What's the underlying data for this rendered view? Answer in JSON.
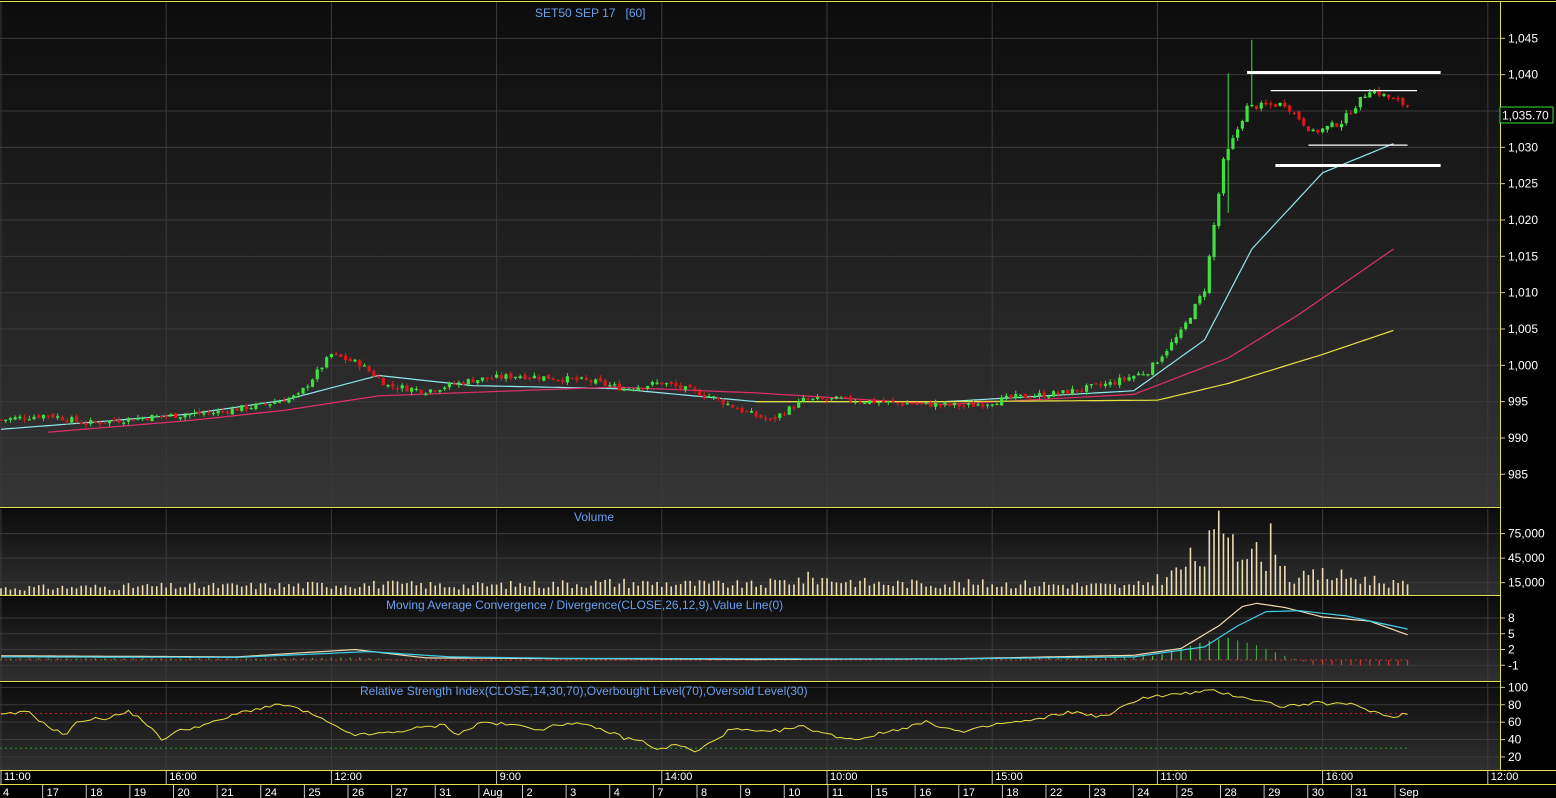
{
  "chart_data": [
    {
      "type": "candlestick",
      "title": "SET50 SEP 17   [60]",
      "price_axis": {
        "ylim": [
          980.5,
          1050
        ],
        "ticks": [
          "1,045",
          "1,040",
          "1,035",
          "1,030",
          "1,025",
          "1,020",
          "1,015",
          "1,010",
          "1,005",
          "1,000",
          "995",
          "990",
          "985"
        ],
        "tick_values": [
          1045,
          1040,
          1035,
          1030,
          1025,
          1020,
          1015,
          1010,
          1005,
          1000,
          995,
          990,
          985
        ]
      },
      "last_price": "1,035.70",
      "last_price_value": 1035.7,
      "bar_count": 240,
      "close_keypoints": [
        [
          0,
          992.5
        ],
        [
          10,
          993.2
        ],
        [
          18,
          992
        ],
        [
          30,
          992.8
        ],
        [
          45,
          993.5
        ],
        [
          55,
          994.5
        ],
        [
          63,
          995.8
        ],
        [
          70,
          1001.5
        ],
        [
          76,
          1000.2
        ],
        [
          82,
          997.2
        ],
        [
          90,
          996.5
        ],
        [
          100,
          998
        ],
        [
          110,
          998.6
        ],
        [
          118,
          998.2
        ],
        [
          125,
          997.8
        ],
        [
          132,
          996.8
        ],
        [
          140,
          997.6
        ],
        [
          150,
          995.8
        ],
        [
          158,
          993.5
        ],
        [
          163,
          992.4
        ],
        [
          170,
          995.2
        ],
        [
          178,
          995.3
        ],
        [
          190,
          994.8
        ],
        [
          205,
          994.4
        ],
        [
          215,
          995.6
        ],
        [
          225,
          996.2
        ],
        [
          235,
          997.5
        ],
        [
          243,
          999.2
        ],
        [
          250,
          1004.5
        ],
        [
          255,
          1010.5
        ],
        [
          259,
          1028
        ],
        [
          264,
          1035.5
        ],
        [
          272,
          1036
        ],
        [
          278,
          1032
        ],
        [
          284,
          1033.5
        ],
        [
          290,
          1038
        ],
        [
          298,
          1035.7
        ]
      ],
      "price_ma_keypoints": [
        {
          "color": "#8ee8ee",
          "points": [
            [
              0,
              991.2
            ],
            [
              20,
              992.2
            ],
            [
              40,
              993.3
            ],
            [
              60,
              995.2
            ],
            [
              80,
              998.6
            ],
            [
              100,
              997.2
            ],
            [
              130,
              996.8
            ],
            [
              160,
              995
            ],
            [
              200,
              995
            ],
            [
              240,
              996.5
            ],
            [
              255,
              1003.5
            ],
            [
              265,
              1016
            ],
            [
              280,
              1026.5
            ],
            [
              295,
              1030.5
            ]
          ]
        },
        {
          "color": "#e0306a",
          "points": [
            [
              10,
              990.8
            ],
            [
              40,
              992.4
            ],
            [
              60,
              993.8
            ],
            [
              80,
              995.8
            ],
            [
              130,
              997
            ],
            [
              160,
              996.2
            ],
            [
              200,
              994.6
            ],
            [
              240,
              996
            ],
            [
              260,
              1001
            ],
            [
              275,
              1007
            ],
            [
              295,
              1016
            ]
          ]
        },
        {
          "color": "#e8e240",
          "points": [
            [
              160,
              995
            ],
            [
              200,
              995
            ],
            [
              245,
              995.2
            ],
            [
              260,
              997.5
            ],
            [
              280,
              1001.5
            ],
            [
              295,
              1004.8
            ]
          ]
        }
      ],
      "drawn_levels": [
        {
          "label": "resistance",
          "value": 1040.3,
          "color": "#ffffff"
        },
        {
          "label": "support",
          "value": 1027.5,
          "color": "#ffffff"
        },
        {
          "label": "range-top",
          "value": 1037.8,
          "color": "#ffffff"
        },
        {
          "label": "range-bottom",
          "value": 1030.3,
          "color": "#ffffff"
        }
      ],
      "x_time_labels": [
        "11:00",
        "16:00",
        "12:00",
        "9:00",
        "14:00",
        "10:00",
        "15:00",
        "11:00",
        "16:00",
        "12:00"
      ],
      "x_time_bars": [
        0,
        35,
        70,
        105,
        140,
        175,
        210,
        245,
        280,
        315
      ],
      "x_date_labels": [
        "4",
        "17",
        "18",
        "19",
        "20",
        "21",
        "24",
        "25",
        "26",
        "27",
        "31",
        "Aug",
        "2",
        "3",
        "4",
        "7",
        "8",
        "9",
        "10",
        "11",
        "15",
        "16",
        "17",
        "18",
        "22",
        "23",
        "24",
        "25",
        "28",
        "29",
        "30",
        "31",
        "Sep"
      ],
      "grid": true,
      "background_gradient": [
        "#101010",
        "#303030"
      ],
      "border_color": "#e8e050"
    },
    {
      "type": "bar",
      "title": "Volume",
      "ylim": [
        0,
        105000
      ],
      "ticks": [
        "75,000",
        "45,000",
        "15,000"
      ],
      "tick_values": [
        75000,
        45000,
        15000
      ],
      "bar_color": "#ecdcb0",
      "volume_keypoints": [
        [
          0,
          9000
        ],
        [
          30,
          11000
        ],
        [
          60,
          12000
        ],
        [
          75,
          14000
        ],
        [
          100,
          12000
        ],
        [
          130,
          16000
        ],
        [
          160,
          13000
        ],
        [
          172,
          22000
        ],
        [
          185,
          15000
        ],
        [
          220,
          14000
        ],
        [
          240,
          11000
        ],
        [
          248,
          26000
        ],
        [
          252,
          44000
        ],
        [
          255,
          48000
        ],
        [
          257,
          72000
        ],
        [
          260,
          100000
        ],
        [
          262,
          70000
        ],
        [
          265,
          62000
        ],
        [
          267,
          40000
        ],
        [
          270,
          80000
        ],
        [
          272,
          32000
        ],
        [
          274,
          20000
        ],
        [
          280,
          26000
        ],
        [
          290,
          20000
        ],
        [
          298,
          12000
        ]
      ]
    },
    {
      "type": "line",
      "title": "Moving Average Convergence / Divergence(CLOSE,26,12,9),Value Line(0)",
      "ylim": [
        -4,
        12
      ],
      "ticks": [
        "8",
        "5",
        "2",
        "-1"
      ],
      "tick_values": [
        8,
        5,
        2,
        -1
      ],
      "series": [
        {
          "name": "MACD",
          "color": "#f0d8b0",
          "points": [
            [
              0,
              0.8
            ],
            [
              50,
              0.6
            ],
            [
              75,
              2.0
            ],
            [
              90,
              0.4
            ],
            [
              110,
              0.3
            ],
            [
              160,
              0.1
            ],
            [
              200,
              0.2
            ],
            [
              240,
              0.9
            ],
            [
              250,
              2.2
            ],
            [
              258,
              6.5
            ],
            [
              263,
              10.2
            ],
            [
              266,
              10.8
            ],
            [
              272,
              10.0
            ],
            [
              280,
              8.2
            ],
            [
              290,
              7.4
            ],
            [
              298,
              4.8
            ]
          ]
        },
        {
          "name": "Signal",
          "color": "#40d0e8",
          "points": [
            [
              0,
              0.6
            ],
            [
              50,
              0.5
            ],
            [
              78,
              1.6
            ],
            [
              95,
              0.6
            ],
            [
              120,
              0.3
            ],
            [
              200,
              0.2
            ],
            [
              240,
              0.6
            ],
            [
              255,
              2.5
            ],
            [
              262,
              6.5
            ],
            [
              268,
              9.2
            ],
            [
              275,
              9.4
            ],
            [
              285,
              8.4
            ],
            [
              298,
              5.9
            ]
          ]
        }
      ],
      "histogram_keypoints": [
        [
          0,
          0.3
        ],
        [
          60,
          0.3
        ],
        [
          75,
          0.5
        ],
        [
          90,
          -0.2
        ],
        [
          160,
          -0.1
        ],
        [
          180,
          0.4
        ],
        [
          230,
          0.3
        ],
        [
          245,
          0.8
        ],
        [
          255,
          3.5
        ],
        [
          260,
          4.2
        ],
        [
          266,
          2.8
        ],
        [
          272,
          0.8
        ],
        [
          278,
          -0.9
        ],
        [
          298,
          -1.1
        ]
      ]
    },
    {
      "type": "line",
      "title": "Relative Strength Index(CLOSE,14,30,70),Overbought Level(70),Oversold Level(30)",
      "ylim": [
        5,
        105
      ],
      "ticks": [
        "100",
        "80",
        "60",
        "40",
        "20"
      ],
      "tick_values": [
        100,
        80,
        60,
        40,
        20
      ],
      "levels": {
        "overbought": 70,
        "oversold": 30
      },
      "series": [
        {
          "name": "RSI",
          "color": "#e8e040",
          "points": [
            [
              0,
              68
            ],
            [
              8,
              72
            ],
            [
              12,
              58
            ],
            [
              18,
              45
            ],
            [
              22,
              62
            ],
            [
              30,
              65
            ],
            [
              36,
              72
            ],
            [
              40,
              62
            ],
            [
              45,
              40
            ],
            [
              50,
              50
            ],
            [
              60,
              60
            ],
            [
              68,
              72
            ],
            [
              75,
              78
            ],
            [
              80,
              80
            ],
            [
              88,
              68
            ],
            [
              95,
              52
            ],
            [
              100,
              45
            ],
            [
              110,
              48
            ],
            [
              115,
              52
            ],
            [
              125,
              57
            ],
            [
              128,
              45
            ],
            [
              135,
              60
            ],
            [
              145,
              56
            ],
            [
              152,
              52
            ],
            [
              160,
              60
            ],
            [
              170,
              50
            ],
            [
              175,
              42
            ],
            [
              180,
              38
            ],
            [
              185,
              28
            ],
            [
              190,
              35
            ],
            [
              195,
              25
            ],
            [
              205,
              52
            ],
            [
              215,
              48
            ],
            [
              225,
              55
            ],
            [
              233,
              45
            ],
            [
              240,
              40
            ],
            [
              250,
              50
            ],
            [
              260,
              60
            ],
            [
              270,
              48
            ],
            [
              280,
              58
            ],
            [
              290,
              62
            ],
            [
              300,
              72
            ],
            [
              310,
              66
            ],
            [
              320,
              88
            ],
            [
              330,
              92
            ],
            [
              340,
              96
            ],
            [
              350,
              88
            ],
            [
              360,
              78
            ],
            [
              370,
              82
            ],
            [
              380,
              80
            ],
            [
              390,
              66
            ],
            [
              395,
              70
            ]
          ]
        }
      ]
    }
  ]
}
